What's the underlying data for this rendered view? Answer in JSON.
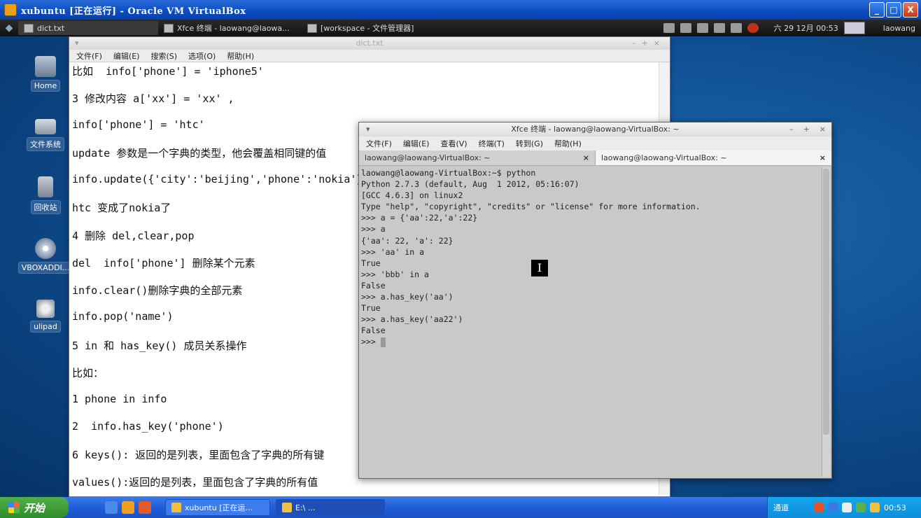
{
  "vbox": {
    "title": "xubuntu [正在运行] - Oracle VM VirtualBox",
    "min": "_",
    "max": "□",
    "close": "X"
  },
  "xfce_panel": {
    "menu_glyph": "◆",
    "tasks": [
      "dict.txt",
      "Xfce 终端 - laowang@laowa...",
      "[workspace - 文件管理器]"
    ],
    "clock": "六 29 12月 00:53",
    "user": "laowang"
  },
  "desktop_icons": [
    {
      "label": "Home",
      "icon": "home-icon"
    },
    {
      "label": "文件系统",
      "icon": "drive-icon"
    },
    {
      "label": "回收站",
      "icon": "trash-icon"
    },
    {
      "label": "VBOXADDI...",
      "icon": "cdrom-icon"
    },
    {
      "label": "ulipad",
      "icon": "app-icon"
    }
  ],
  "editor": {
    "title": "dict.txt",
    "menu": [
      "文件(F)",
      "编辑(E)",
      "搜索(S)",
      "选项(O)",
      "帮助(H)"
    ],
    "lines": [
      "比如  info['phone'] = 'iphone5'",
      "3 修改内容 a['xx'] = 'xx' ,",
      "info['phone'] = 'htc'",
      "update 参数是一个字典的类型，他会覆盖相同键的值",
      "info.update({'city':'beijing','phone':'nokia'})",
      "htc 变成了nokia了",
      "4 删除 del,clear,pop",
      "del  info['phone'] 删除某个元素",
      "info.clear()删除字典的全部元素",
      "info.pop('name')",
      "5 in 和 has_key() 成员关系操作",
      "比如：",
      "1 phone in info",
      "2  info.has_key('phone')",
      "6 keys(): 返回的是列表，里面包含了字典的所有键",
      "values():返回的是列表，里面包含了字典的所有值"
    ]
  },
  "terminal": {
    "title": "Xfce 终端 - laowang@laowang-VirtualBox: ~",
    "menu": [
      "文件(F)",
      "编辑(E)",
      "查看(V)",
      "终端(T)",
      "转到(G)",
      "帮助(H)"
    ],
    "tabs": [
      "laowang@laowang-VirtualBox: ~",
      "laowang@laowang-VirtualBox: ~"
    ],
    "lines": [
      "laowang@laowang-VirtualBox:~$ python",
      "Python 2.7.3 (default, Aug  1 2012, 05:16:07)",
      "[GCC 4.6.3] on linux2",
      "Type \"help\", \"copyright\", \"credits\" or \"license\" for more information.",
      ">>> a = {'aa':22,'a':22}",
      ">>> a",
      "{'aa': 22, 'a': 22}",
      ">>> 'aa' in a",
      "True",
      ">>> 'bbb' in a",
      "False",
      ">>> a.has_key('aa')",
      "True",
      ">>> a.has_key('aa22')",
      "False"
    ],
    "prompt": ">>> "
  },
  "win_taskbar": {
    "start": "开始",
    "tasks": [
      "xubuntu [正在运...",
      "E:\\ ..."
    ],
    "tray_text": "通道",
    "clock": "00:53"
  }
}
